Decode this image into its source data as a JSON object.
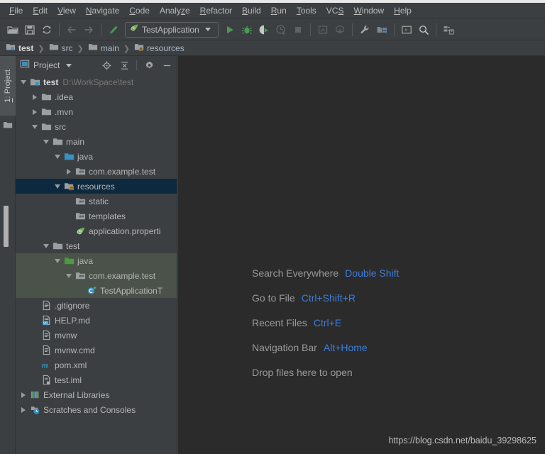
{
  "window": {
    "title_strip_color": "#e8e8e8"
  },
  "menubar": {
    "items": [
      {
        "label": "File",
        "mnemonic": "F"
      },
      {
        "label": "Edit",
        "mnemonic": "E"
      },
      {
        "label": "View",
        "mnemonic": "V"
      },
      {
        "label": "Navigate",
        "mnemonic": "N"
      },
      {
        "label": "Code",
        "mnemonic": "C"
      },
      {
        "label": "Analyze",
        "mnemonic": "z"
      },
      {
        "label": "Refactor",
        "mnemonic": "R"
      },
      {
        "label": "Build",
        "mnemonic": "B"
      },
      {
        "label": "Run",
        "mnemonic": "R"
      },
      {
        "label": "Tools",
        "mnemonic": "T"
      },
      {
        "label": "VCS",
        "mnemonic": "S"
      },
      {
        "label": "Window",
        "mnemonic": "W"
      },
      {
        "label": "Help",
        "mnemonic": "H"
      }
    ]
  },
  "toolbar": {
    "buttons": [
      {
        "name": "open-folder-icon",
        "enabled": true
      },
      {
        "name": "save-all-icon",
        "enabled": true
      },
      {
        "name": "sync-refresh-icon",
        "enabled": true
      },
      {
        "name": "back-arrow-icon",
        "enabled": false
      },
      {
        "name": "forward-arrow-icon",
        "enabled": false
      },
      {
        "name": "build-hammer-icon",
        "enabled": true
      }
    ],
    "run_config": {
      "label": "TestApplication",
      "icon": "spring-boot-leaf-icon",
      "dropdown_icon": "chevron-down-icon"
    },
    "run_buttons": [
      {
        "name": "run-icon",
        "enabled": true
      },
      {
        "name": "debug-icon",
        "enabled": true
      },
      {
        "name": "run-coverage-icon",
        "enabled": true
      },
      {
        "name": "profile-icon",
        "enabled": false
      },
      {
        "name": "stop-icon",
        "enabled": false
      },
      {
        "name": "update-app-icon",
        "enabled": false
      },
      {
        "name": "import-project-icon",
        "enabled": false
      },
      {
        "name": "settings-wrench-icon",
        "enabled": true
      },
      {
        "name": "project-structure-icon",
        "enabled": true
      },
      {
        "name": "terminal-icon",
        "enabled": true
      },
      {
        "name": "search-icon",
        "enabled": true
      },
      {
        "name": "database-icon",
        "enabled": true
      }
    ]
  },
  "breadcrumb": {
    "items": [
      {
        "label": "test",
        "icon": "module-folder-icon",
        "bold": true
      },
      {
        "label": "src",
        "icon": "folder-icon",
        "bold": false
      },
      {
        "label": "main",
        "icon": "folder-icon",
        "bold": false
      },
      {
        "label": "resources",
        "icon": "resources-folder-icon",
        "bold": false
      }
    ],
    "separator": "❯"
  },
  "tool_strip": {
    "project_tab": {
      "label": "1: Project",
      "mnemonic": "1"
    },
    "folder_button": {
      "name": "folder-icon"
    }
  },
  "project_panel": {
    "header": {
      "view_icon": "project-view-icon",
      "title": "Project",
      "dropdown_icon": "chevron-down-icon",
      "locate_icon": "scroll-from-source-icon",
      "collapse_icon": "collapse-all-icon",
      "settings_icon": "gear-icon",
      "hide_icon": "minimize-icon"
    },
    "tree": [
      {
        "label": "test",
        "sub": "D:\\WorkSpace\\test",
        "depth": 0,
        "twisty": "down",
        "icon": "module-folder-icon",
        "bold": true,
        "state": "normal"
      },
      {
        "label": ".idea",
        "sub": "",
        "depth": 1,
        "twisty": "right",
        "icon": "folder-icon",
        "bold": false,
        "state": "normal"
      },
      {
        "label": ".mvn",
        "sub": "",
        "depth": 1,
        "twisty": "right",
        "icon": "folder-icon",
        "bold": false,
        "state": "normal"
      },
      {
        "label": "src",
        "sub": "",
        "depth": 1,
        "twisty": "down",
        "icon": "folder-icon",
        "bold": false,
        "state": "normal"
      },
      {
        "label": "main",
        "sub": "",
        "depth": 2,
        "twisty": "down",
        "icon": "folder-icon",
        "bold": false,
        "state": "normal"
      },
      {
        "label": "java",
        "sub": "",
        "depth": 3,
        "twisty": "down",
        "icon": "source-root-icon",
        "bold": false,
        "state": "normal"
      },
      {
        "label": "com.example.test",
        "sub": "",
        "depth": 4,
        "twisty": "right",
        "icon": "package-icon",
        "bold": false,
        "state": "normal"
      },
      {
        "label": "resources",
        "sub": "",
        "depth": 3,
        "twisty": "down",
        "icon": "resources-folder-icon",
        "bold": false,
        "state": "selected"
      },
      {
        "label": "static",
        "sub": "",
        "depth": 4,
        "twisty": "none",
        "icon": "package-icon",
        "bold": false,
        "state": "normal"
      },
      {
        "label": "templates",
        "sub": "",
        "depth": 4,
        "twisty": "none",
        "icon": "package-icon",
        "bold": false,
        "state": "normal"
      },
      {
        "label": "application.properti",
        "sub": "",
        "depth": 4,
        "twisty": "none",
        "icon": "spring-properties-icon",
        "bold": false,
        "state": "normal"
      },
      {
        "label": "test",
        "sub": "",
        "depth": 2,
        "twisty": "down",
        "icon": "folder-icon",
        "bold": false,
        "state": "normal"
      },
      {
        "label": "java",
        "sub": "",
        "depth": 3,
        "twisty": "down",
        "icon": "test-source-root-icon",
        "bold": false,
        "state": "testroot"
      },
      {
        "label": "com.example.test",
        "sub": "",
        "depth": 4,
        "twisty": "down",
        "icon": "package-icon",
        "bold": false,
        "state": "testroot"
      },
      {
        "label": "TestApplicationT",
        "sub": "",
        "depth": 5,
        "twisty": "none",
        "icon": "class-icon",
        "bold": false,
        "state": "testroot"
      },
      {
        "label": ".gitignore",
        "sub": "",
        "depth": 1,
        "twisty": "none",
        "icon": "file-icon",
        "bold": false,
        "state": "normal"
      },
      {
        "label": "HELP.md",
        "sub": "",
        "depth": 1,
        "twisty": "none",
        "icon": "markdown-file-icon",
        "bold": false,
        "state": "normal"
      },
      {
        "label": "mvnw",
        "sub": "",
        "depth": 1,
        "twisty": "none",
        "icon": "file-icon",
        "bold": false,
        "state": "normal"
      },
      {
        "label": "mvnw.cmd",
        "sub": "",
        "depth": 1,
        "twisty": "none",
        "icon": "file-icon",
        "bold": false,
        "state": "normal"
      },
      {
        "label": "pom.xml",
        "sub": "",
        "depth": 1,
        "twisty": "none",
        "icon": "maven-file-icon",
        "bold": false,
        "state": "normal"
      },
      {
        "label": "test.iml",
        "sub": "",
        "depth": 1,
        "twisty": "none",
        "icon": "iml-file-icon",
        "bold": false,
        "state": "normal"
      },
      {
        "label": "External Libraries",
        "sub": "",
        "depth": 0,
        "twisty": "right",
        "icon": "libraries-icon",
        "bold": false,
        "state": "normal"
      },
      {
        "label": "Scratches and Consoles",
        "sub": "",
        "depth": 0,
        "twisty": "right",
        "icon": "scratches-icon",
        "bold": false,
        "state": "normal"
      }
    ]
  },
  "editor": {
    "hints": [
      {
        "name": "Search Everywhere",
        "key": "Double Shift"
      },
      {
        "name": "Go to File",
        "key": "Ctrl+Shift+R"
      },
      {
        "name": "Recent Files",
        "key": "Ctrl+E"
      },
      {
        "name": "Navigation Bar",
        "key": "Alt+Home"
      },
      {
        "name": "Drop files here to open",
        "key": ""
      }
    ],
    "watermark": "https://blog.csdn.net/baidu_39298625"
  },
  "colors": {
    "panel_bg": "#3c3f41",
    "editor_bg": "#2b2b2b",
    "selection": "#0d293f",
    "test_root": "#4a5249",
    "accent_key": "#3d7ddb",
    "text": "#b7b7b7"
  }
}
